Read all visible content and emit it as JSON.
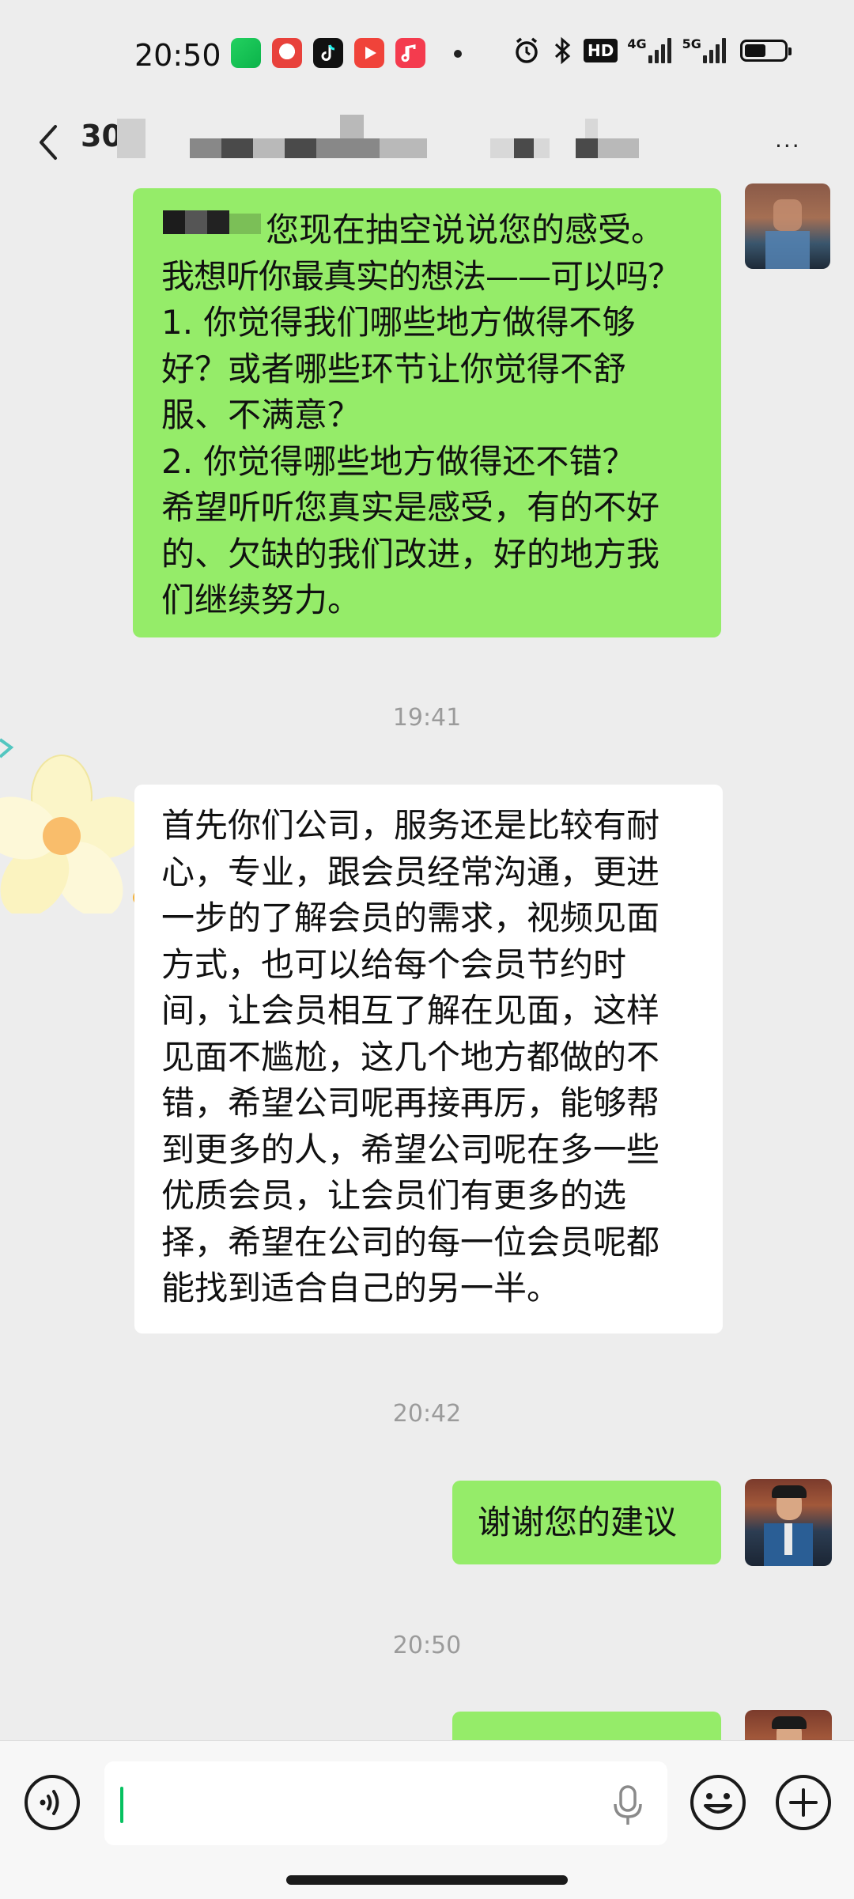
{
  "status_bar": {
    "time": "20:50",
    "network_4g": "4G",
    "network_5g": "5G",
    "hd_label": "HD"
  },
  "header": {
    "contact_name": "306"
  },
  "messages": [
    {
      "id": "msg1",
      "from": "me",
      "lines": [
        "您现在抽空说说您的感受。",
        "我想听你最真实的想法——可以吗？",
        "1. 你觉得我们哪些地方做得不够",
        "好？或者哪些环节让你觉得不舒",
        "服、不满意？",
        "2. 你觉得哪些地方做得还不错？",
        "希望听听您真实是感受，有的不好",
        "的、欠缺的我们改进，好的地方我",
        "们继续努力。"
      ]
    },
    {
      "id": "ts1",
      "timestamp": "19:41"
    },
    {
      "id": "msg2",
      "from": "contact",
      "lines": [
        "首先你们公司，服务还是比较有耐",
        "心，专业，跟会员经常沟通，更进",
        "一步的了解会员的需求，视频见面",
        "方式，也可以给每个会员节约时",
        "间，让会员相互了解在见面，这样",
        "见面不尴尬，这几个地方都做的不",
        "错，希望公司呢再接再厉，能够帮",
        "到更多的人，希望公司呢在多一些",
        "优质会员，让会员们有更多的选",
        "择，希望在公司的每一位会员呢都",
        "能找到适合自己的另一半。"
      ]
    },
    {
      "id": "ts2",
      "timestamp": "20:42"
    },
    {
      "id": "msg3",
      "from": "me",
      "text": "谢谢您的建议"
    },
    {
      "id": "ts3",
      "timestamp": "20:50"
    }
  ],
  "colors": {
    "chat_bg": "#ededed",
    "my_bubble": "#95ec69",
    "their_bubble": "#ffffff",
    "cursor": "#07c160"
  },
  "icons": {
    "back": "chevron-left-icon",
    "voice": "voice-icon",
    "mic": "microphone-icon",
    "emoji": "emoji-icon",
    "add": "plus-icon"
  }
}
